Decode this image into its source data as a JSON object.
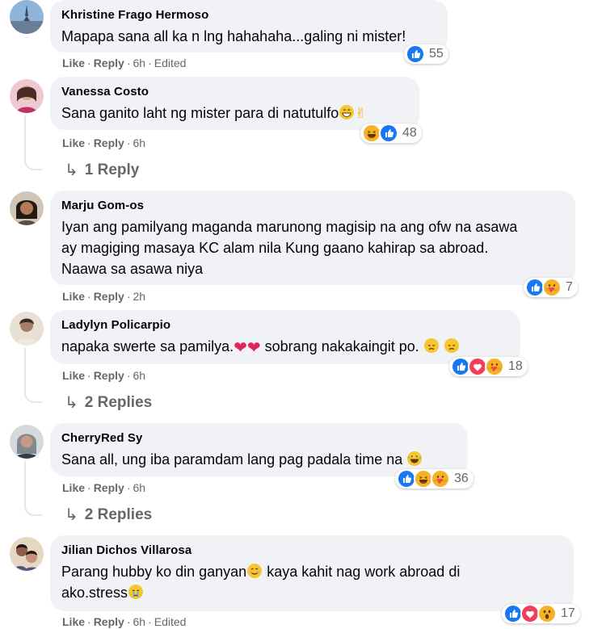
{
  "comments": [
    {
      "author": "Khristine Frago Hermoso",
      "text": "Mapapa sana all ka n lng hahahaha...galing ni mister!",
      "like": "Like",
      "reply": "Reply",
      "time": "6h",
      "edited": "Edited",
      "count": "55"
    },
    {
      "author": "Vanessa Costo",
      "text": "Sana ganito laht ng mister para di natutulfo",
      "like": "Like",
      "reply": "Reply",
      "time": "6h",
      "count": "48",
      "replies": "1 Reply"
    },
    {
      "author": "Marju Gom-os",
      "text1": "Iyan ang pamilyang maganda marunong magisip na ang ofw na asawa",
      "text2": "ay magiging masaya KC alam nila Kung gaano kahirap sa abroad.",
      "text3": "Naawa sa asawa niya",
      "like": "Like",
      "reply": "Reply",
      "time": "2h",
      "count": "7"
    },
    {
      "author": "Ladylyn Policarpio",
      "text_a": "napaka swerte sa pamilya.",
      "text_b": " sobrang nakakaingit po.",
      "like": "Like",
      "reply": "Reply",
      "time": "6h",
      "count": "18",
      "replies": "2 Replies"
    },
    {
      "author": "CherryRed Sy",
      "text": "Sana all, ung iba paramdam lang pag padala time na",
      "like": "Like",
      "reply": "Reply",
      "time": "6h",
      "count": "36",
      "replies": "2 Replies"
    },
    {
      "author": "Jilian Dichos Villarosa",
      "text1": "Parang hubby ko din ganyan",
      "text1b": " kaya kahit nag work abroad di",
      "text2": "ako.stress",
      "like": "Like",
      "reply": "Reply",
      "time": "6h",
      "edited": "Edited",
      "count": "17"
    }
  ],
  "icons": {
    "like": "like-reaction-icon",
    "love": "love-reaction-icon",
    "haha": "haha-reaction-icon",
    "care": "care-reaction-icon",
    "wow": "wow-reaction-icon"
  },
  "colors": {
    "like": "#1877f2",
    "love": "#f33e58",
    "emoji": "#f7b125",
    "bubble": "#f0f2f5",
    "meta": "#65676b"
  }
}
